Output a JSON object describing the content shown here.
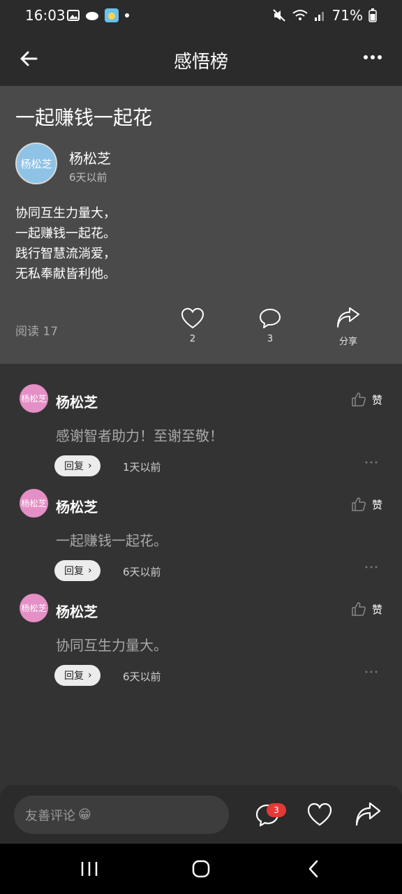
{
  "status": {
    "time": "16:03",
    "battery": "71%"
  },
  "appbar": {
    "title": "感悟榜"
  },
  "post": {
    "title": "一起赚钱一起花",
    "avatar_text": "杨松芝",
    "author": "杨松芝",
    "time": "6天以前",
    "lines": [
      "协同互生力量大，",
      "一起赚钱一起花。",
      "践行智慧流淌爱，",
      "无私奉献皆利他。"
    ],
    "read": "阅读 17",
    "likes": "2",
    "comments": "3",
    "share": "分享"
  },
  "comments": [
    {
      "avatar_text": "杨松芝",
      "name": "杨松芝",
      "like": "赞",
      "text": "感谢智者助力！至谢至敬！",
      "reply": "回复",
      "time": "1天以前"
    },
    {
      "avatar_text": "杨松芝",
      "name": "杨松芝",
      "like": "赞",
      "text": "一起赚钱一起花。",
      "reply": "回复",
      "time": "6天以前"
    },
    {
      "avatar_text": "杨松芝",
      "name": "杨松芝",
      "like": "赞",
      "text": "协同互生力量大。",
      "reply": "回复",
      "time": "6天以前"
    }
  ],
  "bottombar": {
    "placeholder": "友善评论",
    "emoji": "😁",
    "badge": "3"
  },
  "icons": {
    "back": "arrow-left-icon",
    "more": "more-horizontal-icon",
    "heart": "heart-icon",
    "comment": "comment-bubble-icon",
    "share": "share-arrow-icon",
    "thumb": "thumbs-up-icon"
  },
  "colors": {
    "background": "#333333",
    "post_card": "#4a4a4a",
    "bar": "#2b2b2b",
    "avatar_blue": "#8ec3e6",
    "avatar_pink": "#e48fc6",
    "badge": "#e53935"
  }
}
